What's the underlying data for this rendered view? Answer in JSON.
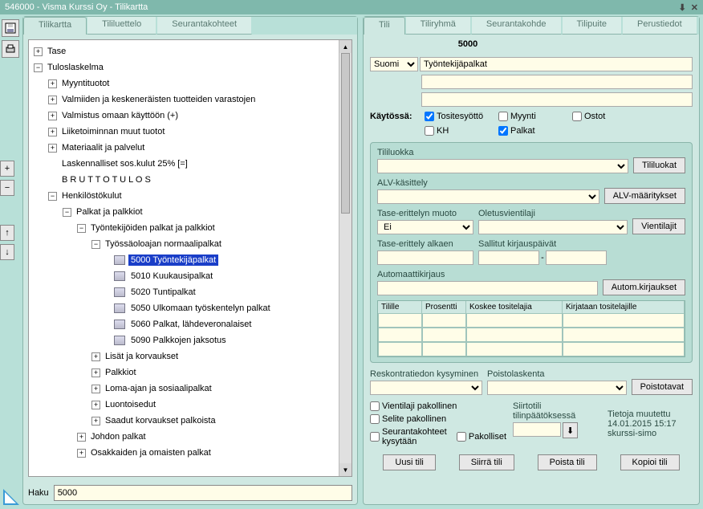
{
  "titlebar": "546000 - Visma Kurssi Oy - Tilikartta",
  "tabs_left": [
    "Tilikartta",
    "Tililuettelo",
    "Seurantakohteet"
  ],
  "tabs_right": [
    "Tili",
    "Tiliryhmä",
    "Seurantakohde",
    "Tilipuite",
    "Perustiedot"
  ],
  "haku_label": "Haku",
  "haku_value": "5000",
  "tree": {
    "n0": "Tase",
    "n1": "Tuloslaskelma",
    "n2": "Myyntituotot",
    "n3": "Valmiiden ja keskeneräisten tuotteiden varastojen",
    "n4": "Valmistus omaan käyttöön (+)",
    "n5": "Liiketoiminnan muut tuotot",
    "n6": "Materiaalit ja palvelut",
    "n7": "Laskennalliset sos.kulut 25% [=]",
    "n8": "B R U T T O T U L O S",
    "n9": "Henkilöstökulut",
    "n10": "Palkat ja palkkiot",
    "n11": "Työntekijöiden palkat ja palkkiot",
    "n12": "Työssäoloajan normaalipalkat",
    "l1": "5000 Työntekijäpalkat",
    "l2": "5010 Kuukausipalkat",
    "l3": "5020 Tuntipalkat",
    "l4": "5050 Ulkomaan työskentelyn palkat",
    "l5": "5060 Palkat, lähdeveronalaiset",
    "l6": "5090 Palkkojen jaksotus",
    "n13": "Lisät ja korvaukset",
    "n14": "Palkkiot",
    "n15": "Loma-ajan ja sosiaalipalkat",
    "n16": "Luontoisedut",
    "n17": "Saadut korvaukset palkoista",
    "n18": "Johdon palkat",
    "n19": "Osakkaiden ja omaisten palkat"
  },
  "right": {
    "code": "5000",
    "lang": "Suomi",
    "name": "Työntekijäpalkat",
    "kaytossa_label": "Käytössä:",
    "chk_tositesyotto": "Tositesyöttö",
    "chk_myynti": "Myynti",
    "chk_ostot": "Ostot",
    "chk_kh": "KH",
    "chk_palkat": "Palkat",
    "tililuokka_label": "Tililuokka",
    "tililuokat_btn": "Tililuokat",
    "alv_label": "ALV-käsittely",
    "alv_btn": "ALV-määritykset",
    "tase_muoto_label": "Tase-erittelyn muoto",
    "tase_muoto_value": "Ei",
    "oletusvientilaji_label": "Oletusvientilaji",
    "vientilajit_btn": "Vientilajit",
    "tase_alkaen_label": "Tase-erittely alkaen",
    "sallitut_label": "Sallitut kirjauspäivät",
    "autokirjaus_label": "Automaattikirjaus",
    "autokirjaus_btn": "Autom.kirjaukset",
    "grid_headers": [
      "Tilille",
      "Prosentti",
      "Koskee tositelajia",
      "Kirjataan tositelajille"
    ],
    "reskontra_label": "Reskontratiedon kysyminen",
    "poistolaskenta_label": "Poistolaskenta",
    "poistotavat_btn": "Poistotavat",
    "vientilaji_pak": "Vientilaji pakollinen",
    "selite_pak": "Selite pakollinen",
    "seurantakohteet_kys": "Seurantakohteet kysytään",
    "pakolliset": "Pakolliset",
    "siirtotili_label": "Siirtotili tilinpäätöksessä",
    "tietoja_muutettu": "Tietoja muutettu",
    "tietoja_date": "14.01.2015 15:17",
    "tietoja_user": "skurssi-simo",
    "btn_uusi": "Uusi tili",
    "btn_siirra": "Siirrä tili",
    "btn_poista": "Poista tili",
    "btn_kopioi": "Kopioi tili"
  }
}
